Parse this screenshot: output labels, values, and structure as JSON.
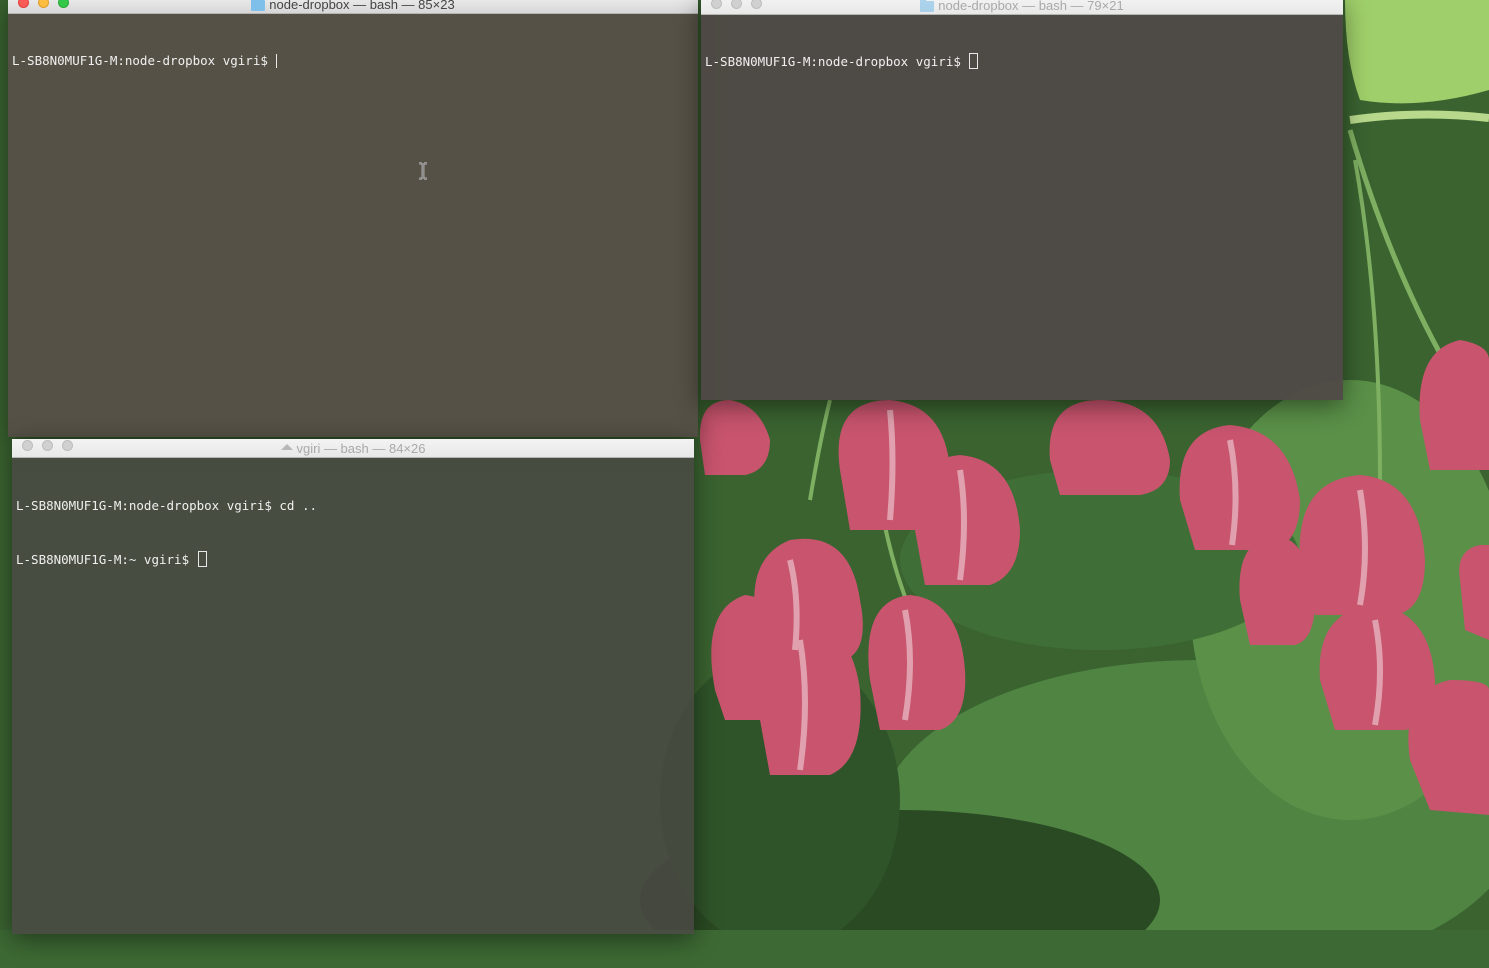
{
  "windows": {
    "top_left": {
      "title": "node-dropbox — bash — 85×23",
      "lines": [
        {
          "text": "L-SB8N0MUF1G-M:node-dropbox vgiri$ ",
          "cursor": "bar"
        }
      ]
    },
    "top_right": {
      "title": "node-dropbox — bash — 79×21",
      "lines": [
        {
          "text": "L-SB8N0MUF1G-M:node-dropbox vgiri$ ",
          "cursor": "block"
        }
      ]
    },
    "bottom_left": {
      "title": "vgiri — bash — 84×26",
      "lines": [
        {
          "text": "L-SB8N0MUF1G-M:node-dropbox vgiri$ cd ..",
          "cursor": "none"
        },
        {
          "text": "L-SB8N0MUF1G-M:~ vgiri$ ",
          "cursor": "block"
        }
      ]
    }
  },
  "icons": {
    "folder": "folder-icon",
    "home": "home-icon",
    "text_cursor": "ibeam-cursor-icon"
  },
  "colors": {
    "terminal_bg": "#4d4845",
    "terminal_text": "#f0f0f0",
    "close": "#fc5b57",
    "minimize": "#fdbd41",
    "maximize": "#34c84a"
  }
}
